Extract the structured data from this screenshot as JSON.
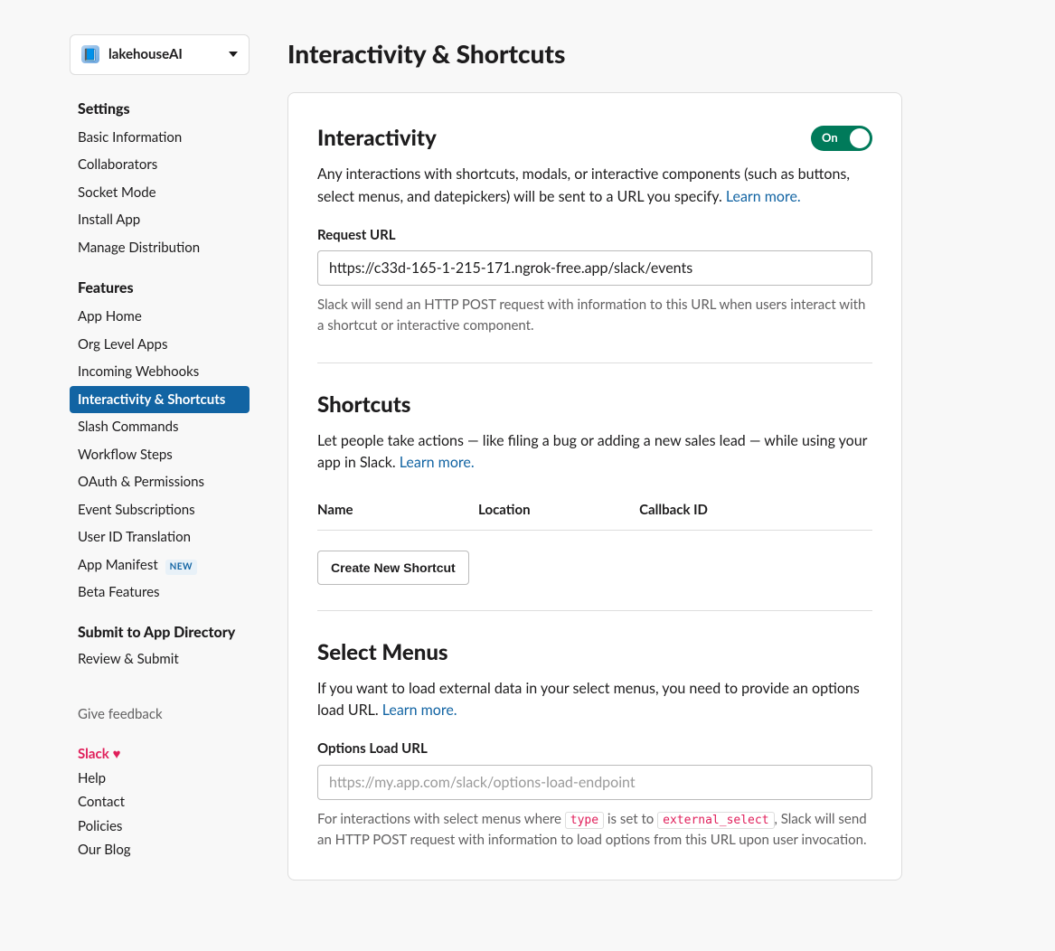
{
  "sidebar": {
    "app_name": "lakehouseAI",
    "sections": [
      {
        "title": "Settings",
        "items": [
          {
            "label": "Basic Information"
          },
          {
            "label": "Collaborators"
          },
          {
            "label": "Socket Mode"
          },
          {
            "label": "Install App"
          },
          {
            "label": "Manage Distribution"
          }
        ]
      },
      {
        "title": "Features",
        "items": [
          {
            "label": "App Home"
          },
          {
            "label": "Org Level Apps"
          },
          {
            "label": "Incoming Webhooks"
          },
          {
            "label": "Interactivity & Shortcuts",
            "active": true
          },
          {
            "label": "Slash Commands"
          },
          {
            "label": "Workflow Steps"
          },
          {
            "label": "OAuth & Permissions"
          },
          {
            "label": "Event Subscriptions"
          },
          {
            "label": "User ID Translation"
          },
          {
            "label": "App Manifest",
            "badge": "NEW"
          },
          {
            "label": "Beta Features"
          }
        ]
      },
      {
        "title": "Submit to App Directory",
        "items": [
          {
            "label": "Review & Submit"
          }
        ]
      }
    ],
    "footer": {
      "feedback": "Give feedback",
      "slack": "Slack",
      "links": [
        "Help",
        "Contact",
        "Policies",
        "Our Blog"
      ]
    }
  },
  "page": {
    "title": "Interactivity & Shortcuts",
    "interactivity": {
      "title": "Interactivity",
      "toggle_label": "On",
      "desc": "Any interactions with shortcuts, modals, or interactive components (such as buttons, select menus, and datepickers) will be sent to a URL you specify.",
      "learn_more": "Learn more.",
      "request_url_label": "Request URL",
      "request_url_value": "https://c33d-165-1-215-171.ngrok-free.app/slack/events",
      "request_url_help": "Slack will send an HTTP POST request with information to this URL when users interact with a shortcut or interactive component."
    },
    "shortcuts": {
      "title": "Shortcuts",
      "desc": "Let people take actions — like filing a bug or adding a new sales lead — while using your app in Slack.",
      "learn_more": "Learn more.",
      "columns": [
        "Name",
        "Location",
        "Callback ID"
      ],
      "create_button": "Create New Shortcut"
    },
    "select_menus": {
      "title": "Select Menus",
      "desc": "If you want to load external data in your select menus, you need to provide an options load URL.",
      "learn_more": "Learn more.",
      "options_url_label": "Options Load URL",
      "options_url_placeholder": "https://my.app.com/slack/options-load-endpoint",
      "help_prefix": "For interactions with select menus where ",
      "code1": "type",
      "help_mid": " is set to ",
      "code2": "external_select",
      "help_suffix": ", Slack will send an HTTP POST request with information to load options from this URL upon user invocation."
    }
  }
}
